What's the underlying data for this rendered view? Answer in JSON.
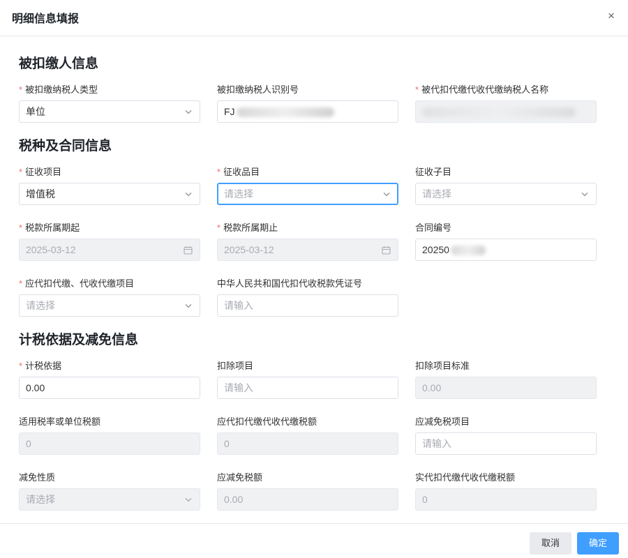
{
  "dialog": {
    "title": "明细信息填报",
    "close_symbol": "×"
  },
  "sections": {
    "withholdee": "被扣缴人信息",
    "tax": "税种及合同信息",
    "basis": "计税依据及减免信息"
  },
  "fields": {
    "taxpayer_type": {
      "label": "被扣缴纳税人类型",
      "value": "单位",
      "required": true
    },
    "taxpayer_id": {
      "label": "被扣缴纳税人识别号",
      "value": "FJ"
    },
    "agent_name": {
      "label": "被代扣代缴代收代缴纳税人名称",
      "value": "",
      "required": true
    },
    "levy_item": {
      "label": "征收项目",
      "value": "增值税",
      "required": true
    },
    "levy_category": {
      "label": "征收品目",
      "placeholder": "请选择",
      "required": true
    },
    "levy_subitem": {
      "label": "征收子目",
      "placeholder": "请选择"
    },
    "period_start": {
      "label": "税款所属期起",
      "value": "2025-03-12",
      "required": true
    },
    "period_end": {
      "label": "税款所属期止",
      "value": "2025-03-12",
      "required": true
    },
    "contract_no": {
      "label": "合同编号",
      "value": "20250"
    },
    "withhold_item": {
      "label": "应代扣代缴、代收代缴项目",
      "placeholder": "请选择",
      "required": true
    },
    "voucher_no": {
      "label": "中华人民共和国代扣代收税款凭证号",
      "placeholder": "请输入"
    },
    "tax_basis": {
      "label": "计税依据",
      "value": "0.00",
      "required": true
    },
    "deduction_item": {
      "label": "扣除项目",
      "placeholder": "请输入"
    },
    "deduction_standard": {
      "label": "扣除项目标准",
      "value": "0.00"
    },
    "tax_rate": {
      "label": "适用税率或单位税额",
      "value": "0"
    },
    "payable_tax": {
      "label": "应代扣代缴代收代缴税额",
      "value": "0"
    },
    "exempt_item": {
      "label": "应减免税项目",
      "placeholder": "请输入"
    },
    "exempt_nature": {
      "label": "减免性质",
      "placeholder": "请选择"
    },
    "exempt_amount": {
      "label": "应减免税额",
      "value": "0.00"
    },
    "actual_tax": {
      "label": "实代扣代缴代收代缴税额",
      "value": "0"
    }
  },
  "footer": {
    "cancel_label": "取消",
    "confirm_label": "确定"
  },
  "colors": {
    "primary": "#409eff",
    "required": "#f56c6c",
    "disabled_bg": "#f0f1f3"
  }
}
